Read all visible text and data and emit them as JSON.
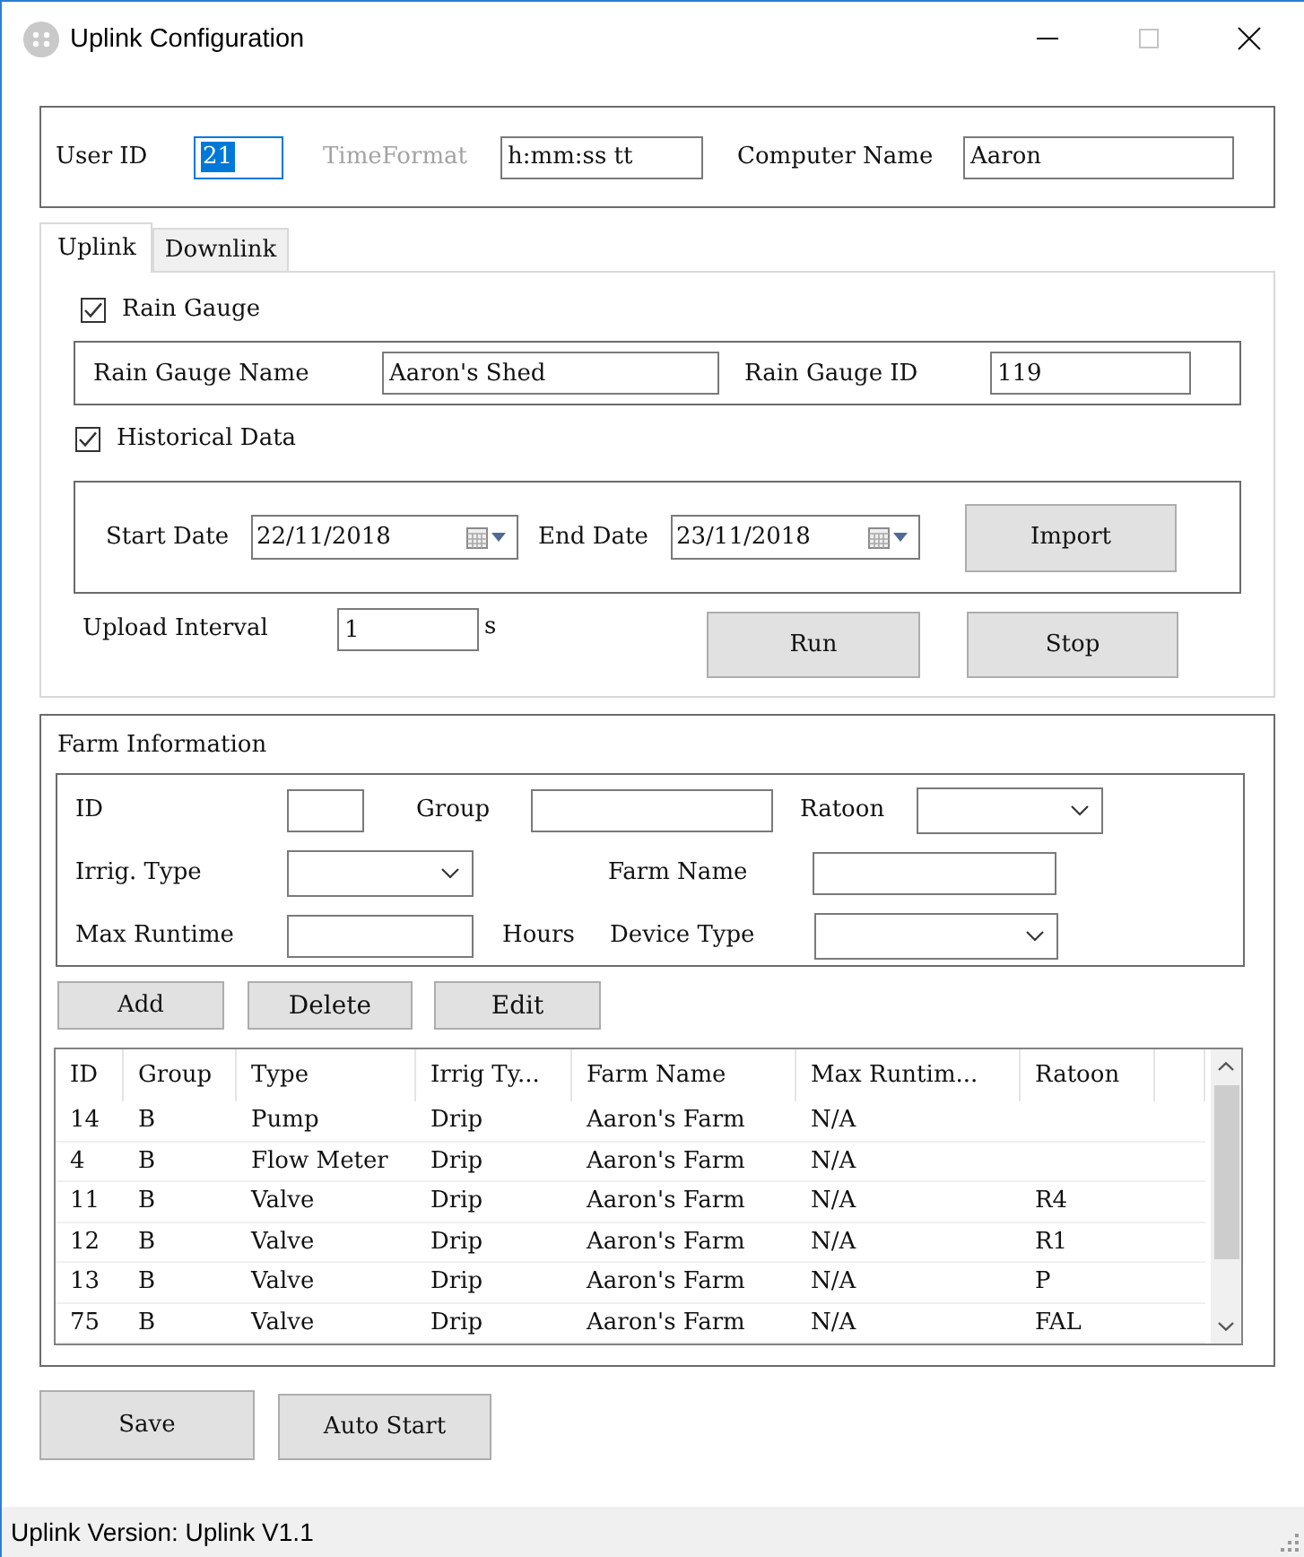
{
  "window": {
    "title": "Uplink Configuration",
    "controls": [
      {
        "kind": "minimize",
        "disabled": false
      },
      {
        "kind": "maximize",
        "disabled": true
      },
      {
        "kind": "close",
        "disabled": false
      }
    ]
  },
  "user_settings": {
    "fields": [
      {
        "label": "User ID",
        "value": "21",
        "label_disabled": false,
        "text_selected": true
      },
      {
        "label": "TimeFormat",
        "value": "h:mm:ss tt",
        "label_disabled": true,
        "text_selected": false
      },
      {
        "label": "Computer Name",
        "value": "Aaron",
        "label_disabled": false,
        "text_selected": false
      }
    ]
  },
  "tabs": [
    {
      "label": "Uplink",
      "selected": true
    },
    {
      "label": "Downlink",
      "selected": false
    }
  ],
  "uplink": {
    "rain_gauge": {
      "label": "Rain Gauge",
      "checked": true,
      "fields": [
        {
          "label": "Rain Gauge Name",
          "value": "Aaron's Shed"
        },
        {
          "label": "Rain Gauge ID",
          "value": "119"
        }
      ]
    },
    "historical_data": {
      "label": "Historical Data",
      "checked": true,
      "dates": [
        {
          "label": "Start Date",
          "value": "22/11/2018"
        },
        {
          "label": "End Date",
          "value": "23/11/2018"
        }
      ],
      "button": "Import"
    },
    "upload_interval": {
      "label": "Upload Interval",
      "value": "1",
      "unit": "s"
    },
    "buttons": [
      "Run",
      "Stop"
    ]
  },
  "farm_information": {
    "title": "Farm Information",
    "field_rows": [
      [
        {
          "label": "ID",
          "kind": "text"
        },
        {
          "label": "Group",
          "kind": "text"
        },
        {
          "label": "Ratoon",
          "kind": "dropdown"
        }
      ],
      [
        {
          "label": "Irrig. Type",
          "kind": "dropdown"
        },
        {
          "label": "Farm Name",
          "kind": "text"
        }
      ],
      [
        {
          "label": "Max Runtime",
          "kind": "text",
          "unit": "Hours"
        },
        {
          "label": "Device Type",
          "kind": "dropdown"
        }
      ]
    ],
    "buttons": [
      "Add",
      "Delete",
      "Edit"
    ],
    "table": {
      "columns": [
        "ID",
        "Group",
        "Type",
        "Irrig Ty...",
        "Farm Name",
        "Max Runtim...",
        "Ratoon"
      ],
      "rows": [
        [
          "14",
          "B",
          "Pump",
          "Drip",
          "Aaron's Farm",
          "N/A"
        ],
        [
          "4",
          "B",
          "Flow Meter",
          "Drip",
          "Aaron's Farm",
          "N/A"
        ],
        [
          "11",
          "B",
          "Valve",
          "Drip",
          "Aaron's Farm",
          "N/A",
          "R4"
        ],
        [
          "12",
          "B",
          "Valve",
          "Drip",
          "Aaron's Farm",
          "N/A",
          "R1"
        ],
        [
          "13",
          "B",
          "Valve",
          "Drip",
          "Aaron's Farm",
          "N/A",
          "P"
        ],
        [
          "75",
          "B",
          "Valve",
          "Drip",
          "Aaron's Farm",
          "N/A",
          "FAL"
        ]
      ]
    }
  },
  "footer_buttons": [
    "Save",
    "Auto Start"
  ],
  "status_bar": {
    "text": "Uplink Version: Uplink V1.1"
  }
}
